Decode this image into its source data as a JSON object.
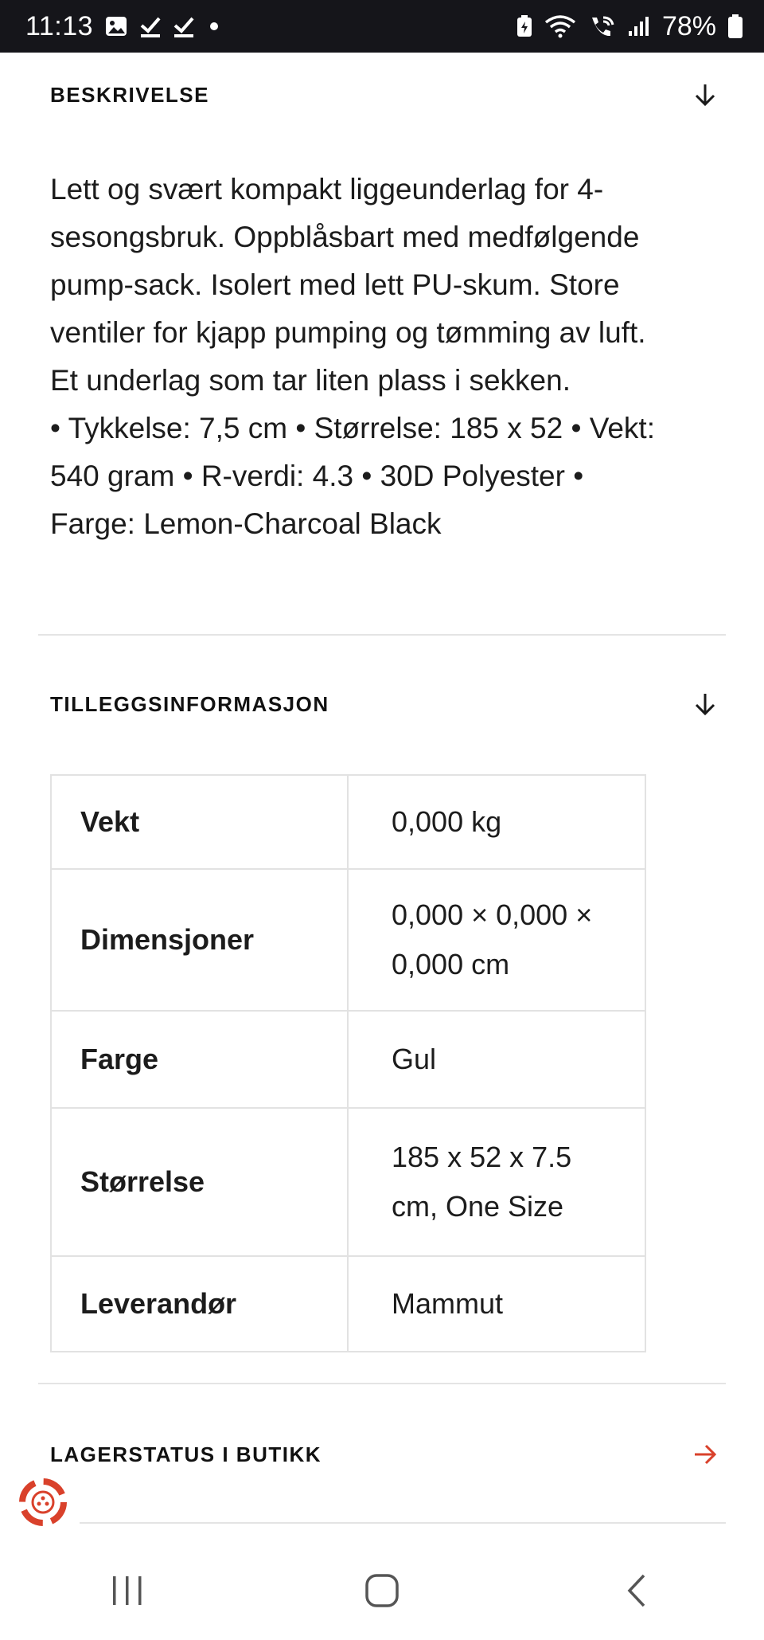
{
  "status_bar": {
    "time": "11:13",
    "battery_percent": "78%",
    "left_icons": [
      "gallery-icon",
      "check-icon",
      "check-icon",
      "dot-icon"
    ],
    "right_icons": [
      "battery-saver-icon",
      "wifi-icon",
      "wifi-call-icon",
      "signal-icon",
      "battery-icon"
    ]
  },
  "description": {
    "title": "BESKRIVELSE",
    "paragraph": "Lett og svært kompakt liggeunderlag for 4-sesongsbruk. Oppblåsbart med medfølgende pump-sack. Isolert med lett PU-skum. Store ventiler for kjapp pumping og tømming av luft. Et underlag som tar liten plass i sekken.",
    "specs": "• Tykkelse: 7,5 cm • Størrelse: 185 x 52 • Vekt: 540 gram • R-verdi: 4.3 • 30D Polyester • Farge: Lemon-Charcoal Black"
  },
  "additional_info": {
    "title": "TILLEGGSINFORMASJON",
    "rows": [
      {
        "label": "Vekt",
        "value": "0,000 kg"
      },
      {
        "label": "Dimensjoner",
        "value": "0,000 × 0,000 × 0,000 cm"
      },
      {
        "label": "Farge",
        "value": "Gul"
      },
      {
        "label": "Størrelse",
        "value": "185 x 52 x 7.5 cm, One Size"
      },
      {
        "label": "Leverandør",
        "value": "Mammut"
      }
    ]
  },
  "stock": {
    "title": "LAGERSTATUS I BUTIKK",
    "arrow_color": "#d9412b"
  },
  "colors": {
    "status_bar_bg": "#15151a",
    "accent": "#d9412b",
    "divider": "#e4e4e4"
  },
  "nav_bar": {
    "icons": [
      "recent-apps-icon",
      "home-icon",
      "back-icon"
    ]
  }
}
